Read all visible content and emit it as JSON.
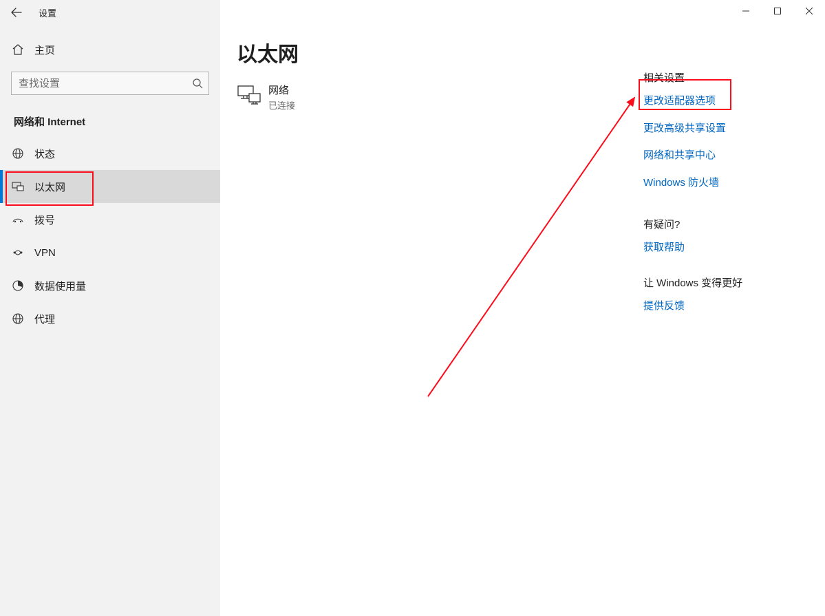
{
  "app": {
    "title": "设置"
  },
  "home": {
    "label": "主页"
  },
  "search": {
    "placeholder": "查找设置"
  },
  "category": "网络和 Internet",
  "nav": {
    "status": {
      "label": "状态"
    },
    "ethernet": {
      "label": "以太网"
    },
    "dialup": {
      "label": "拨号"
    },
    "vpn": {
      "label": "VPN"
    },
    "datausage": {
      "label": "数据使用量"
    },
    "proxy": {
      "label": "代理"
    }
  },
  "page": {
    "title": "以太网",
    "network": {
      "name": "网络",
      "status": "已连接"
    }
  },
  "rail": {
    "related_heading": "相关设置",
    "links": {
      "adapter": "更改适配器选项",
      "sharing": "更改高级共享设置",
      "center": "网络和共享中心",
      "firewall": "Windows 防火墙"
    },
    "question_heading": "有疑问?",
    "help_link": "获取帮助",
    "improve_heading": "让 Windows 变得更好",
    "feedback_link": "提供反馈"
  }
}
